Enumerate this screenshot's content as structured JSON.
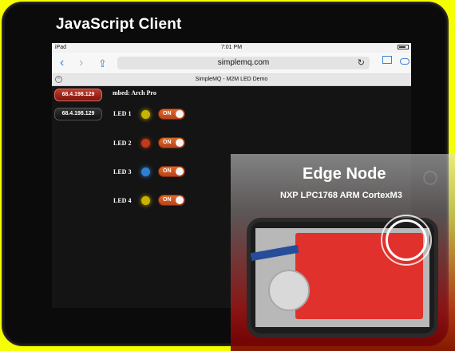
{
  "header": {
    "title": "JavaScript Client"
  },
  "statusbar": {
    "device": "iPad",
    "time": "7:01 PM"
  },
  "browser": {
    "url": "simplemq.com",
    "tab_title": "SimpleMQ - M2M LED Demo"
  },
  "app": {
    "ip_buttons": [
      "68.4.198.129",
      "68.4.198.129"
    ],
    "device_title": "mbed: Arch Pro",
    "leds": [
      {
        "label": "LED 1",
        "color": "#c9b300",
        "state": "ON"
      },
      {
        "label": "LED 2",
        "color": "#c23a1a",
        "state": "ON"
      },
      {
        "label": "LED 3",
        "color": "#2f80d0",
        "state": "ON"
      },
      {
        "label": "LED 4",
        "color": "#c9b300",
        "state": "ON"
      }
    ]
  },
  "edge": {
    "title": "Edge Node",
    "subtitle": "NXP LPC1768 ARM CortexM3"
  }
}
